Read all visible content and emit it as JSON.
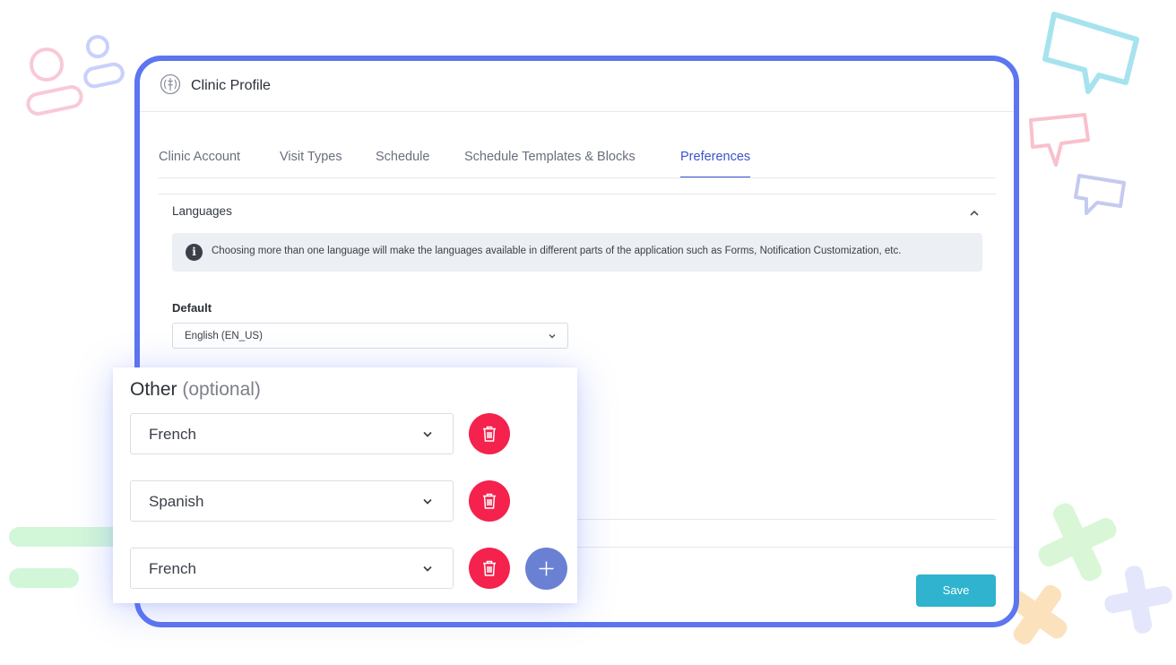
{
  "colors": {
    "frame": "#5d75f0",
    "active_tab": "#3a54cf",
    "save_button": "#2fb3cf",
    "delete_button": "#f4224d",
    "add_button": "#6a80d3"
  },
  "card": {
    "title": "Clinic Profile",
    "logo_icon": "clinic-logo-icon"
  },
  "tabs": [
    {
      "label": "Clinic Account",
      "active": false
    },
    {
      "label": "Visit Types",
      "active": false
    },
    {
      "label": "Schedule",
      "active": false
    },
    {
      "label": "Schedule Templates & Blocks",
      "active": false
    },
    {
      "label": "Preferences",
      "active": true
    }
  ],
  "languages": {
    "section_title": "Languages",
    "collapse_icon": "chevron-up-icon",
    "info_icon": "info-icon",
    "info_text": "Choosing more than one language will make the languages available in different parts of the application such as Forms, Notification Customization, etc.",
    "default_label": "Default",
    "default_value": "English (EN_US)"
  },
  "other": {
    "title": "Other",
    "title_suffix": "(optional)",
    "items": [
      {
        "value": "French"
      },
      {
        "value": "Spanish"
      },
      {
        "value": "French"
      }
    ],
    "delete_icon": "trash-icon",
    "add_icon": "plus-icon"
  },
  "footer": {
    "save_label": "Save"
  }
}
